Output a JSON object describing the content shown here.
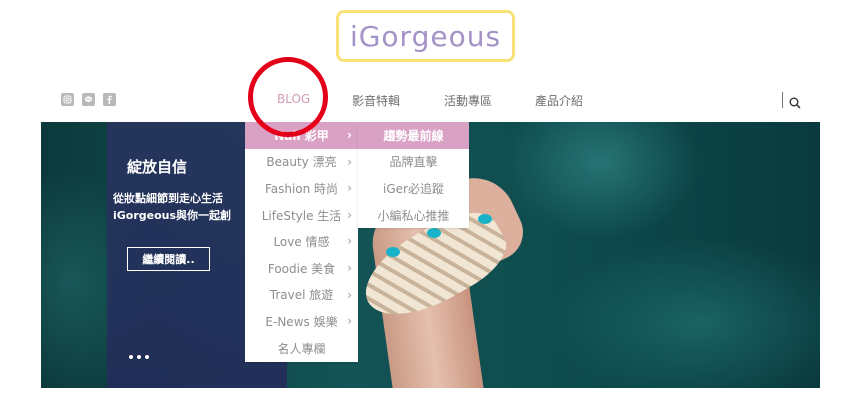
{
  "brand": {
    "logo_text": "iGorgeous"
  },
  "social": {
    "icons": [
      "instagram-icon",
      "line-icon",
      "facebook-icon"
    ]
  },
  "nav": {
    "items": [
      {
        "label": "BLOG"
      },
      {
        "label": "影音特輯"
      },
      {
        "label": "活動專區"
      },
      {
        "label": "產品介紹"
      }
    ],
    "search_icon": "search-icon"
  },
  "blog_menu": {
    "items": [
      {
        "label": "Nail 彩甲"
      },
      {
        "label": "Beauty 漂亮"
      },
      {
        "label": "Fashion 時尚"
      },
      {
        "label": "LifeStyle 生活"
      },
      {
        "label": "Love 情感"
      },
      {
        "label": "Foodie 美食"
      },
      {
        "label": "Travel 旅遊"
      },
      {
        "label": "E-News 娛樂"
      },
      {
        "label": "名人專欄"
      }
    ],
    "arrow": "›"
  },
  "submenu": {
    "items": [
      {
        "label": "趨勢最前線"
      },
      {
        "label": "品牌直擊"
      },
      {
        "label": "iGer必追蹤"
      },
      {
        "label": "小編私心推推"
      }
    ]
  },
  "hero": {
    "title": "綻放自信",
    "desc_line1": "從妝點細節到走心生活",
    "desc_line2": "iGorgeous與你一起創",
    "cta_label": "繼續閱讀.."
  },
  "colors": {
    "accent_pink": "#d9a2c5",
    "logo_purple": "#a493c6",
    "logo_border": "#f7e27a",
    "annotation_red": "#e50019"
  }
}
